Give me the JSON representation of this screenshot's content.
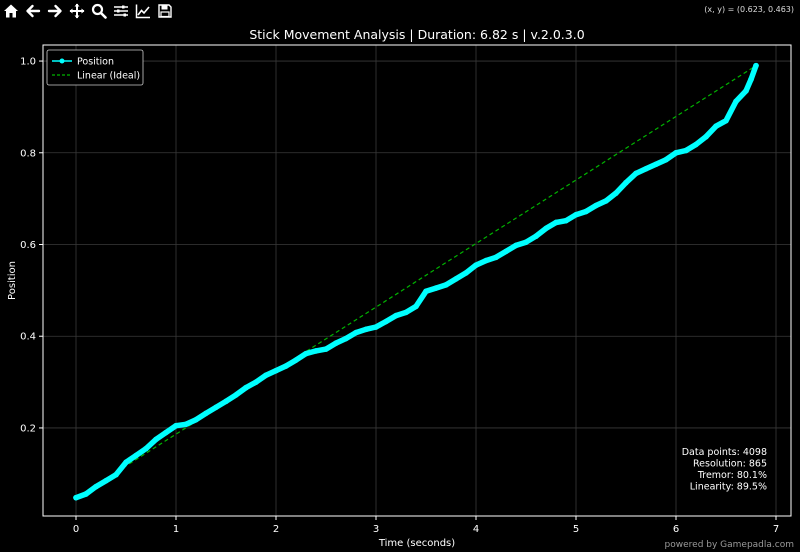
{
  "toolbar": {
    "buttons": [
      {
        "name": "home-button",
        "icon": "home-icon"
      },
      {
        "name": "back-button",
        "icon": "arrow-left-icon"
      },
      {
        "name": "forward-button",
        "icon": "arrow-right-icon"
      },
      {
        "name": "pan-button",
        "icon": "move-icon"
      },
      {
        "name": "zoom-button",
        "icon": "zoom-icon"
      },
      {
        "name": "configure-subplots-button",
        "icon": "sliders-icon"
      },
      {
        "name": "edit-axes-button",
        "icon": "line-chart-icon"
      },
      {
        "name": "save-button",
        "icon": "save-icon"
      }
    ],
    "coords": "(x, y) = (0.623, 0.463)"
  },
  "footer": "powered by Gamepadla.com",
  "colors": {
    "position": "#00ffff",
    "linear": "#00b300",
    "background": "#000000",
    "grid": "#3a3a3a"
  },
  "chart_data": {
    "type": "line",
    "title": "Stick Movement Analysis | Duration: 6.82 s | v.2.0.3.0",
    "xlabel": "Time (seconds)",
    "ylabel": "Position",
    "xlim": [
      -0.33,
      7.15
    ],
    "ylim": [
      0.008,
      1.035
    ],
    "xticks": [
      0,
      1,
      2,
      3,
      4,
      5,
      6,
      7
    ],
    "yticks": [
      0.2,
      0.4,
      0.6,
      0.8,
      1.0
    ],
    "grid": true,
    "legend": "top-left",
    "series": [
      {
        "name": "Position",
        "style": "solid-markers",
        "color": "#00ffff",
        "x": [
          0.0,
          0.1,
          0.2,
          0.3,
          0.4,
          0.5,
          0.6,
          0.7,
          0.8,
          0.9,
          1.0,
          1.1,
          1.2,
          1.3,
          1.4,
          1.5,
          1.6,
          1.7,
          1.8,
          1.9,
          2.0,
          2.1,
          2.2,
          2.3,
          2.4,
          2.5,
          2.6,
          2.7,
          2.8,
          2.9,
          3.0,
          3.1,
          3.2,
          3.3,
          3.4,
          3.5,
          3.6,
          3.7,
          3.8,
          3.9,
          4.0,
          4.1,
          4.2,
          4.3,
          4.4,
          4.5,
          4.6,
          4.7,
          4.8,
          4.9,
          5.0,
          5.1,
          5.2,
          5.3,
          5.4,
          5.5,
          5.6,
          5.7,
          5.8,
          5.9,
          6.0,
          6.1,
          6.2,
          6.3,
          6.4,
          6.5,
          6.6,
          6.7,
          6.75,
          6.8
        ],
        "y": [
          0.048,
          0.056,
          0.072,
          0.085,
          0.098,
          0.125,
          0.14,
          0.155,
          0.175,
          0.19,
          0.205,
          0.208,
          0.218,
          0.232,
          0.245,
          0.258,
          0.272,
          0.288,
          0.3,
          0.315,
          0.325,
          0.335,
          0.348,
          0.362,
          0.368,
          0.372,
          0.385,
          0.395,
          0.408,
          0.415,
          0.42,
          0.432,
          0.445,
          0.452,
          0.465,
          0.498,
          0.505,
          0.512,
          0.525,
          0.538,
          0.555,
          0.565,
          0.572,
          0.585,
          0.598,
          0.605,
          0.618,
          0.635,
          0.648,
          0.652,
          0.665,
          0.672,
          0.685,
          0.695,
          0.712,
          0.735,
          0.755,
          0.765,
          0.775,
          0.785,
          0.8,
          0.805,
          0.818,
          0.835,
          0.858,
          0.87,
          0.912,
          0.935,
          0.96,
          0.99
        ]
      },
      {
        "name": "Linear (Ideal)",
        "style": "dashed",
        "color": "#00b300",
        "x": [
          0.0,
          6.8
        ],
        "y": [
          0.048,
          0.99
        ]
      }
    ],
    "annotations": [
      "Data points: 4098",
      "Resolution: 865",
      "Tremor: 80.1%",
      "Linearity: 89.5%"
    ]
  }
}
